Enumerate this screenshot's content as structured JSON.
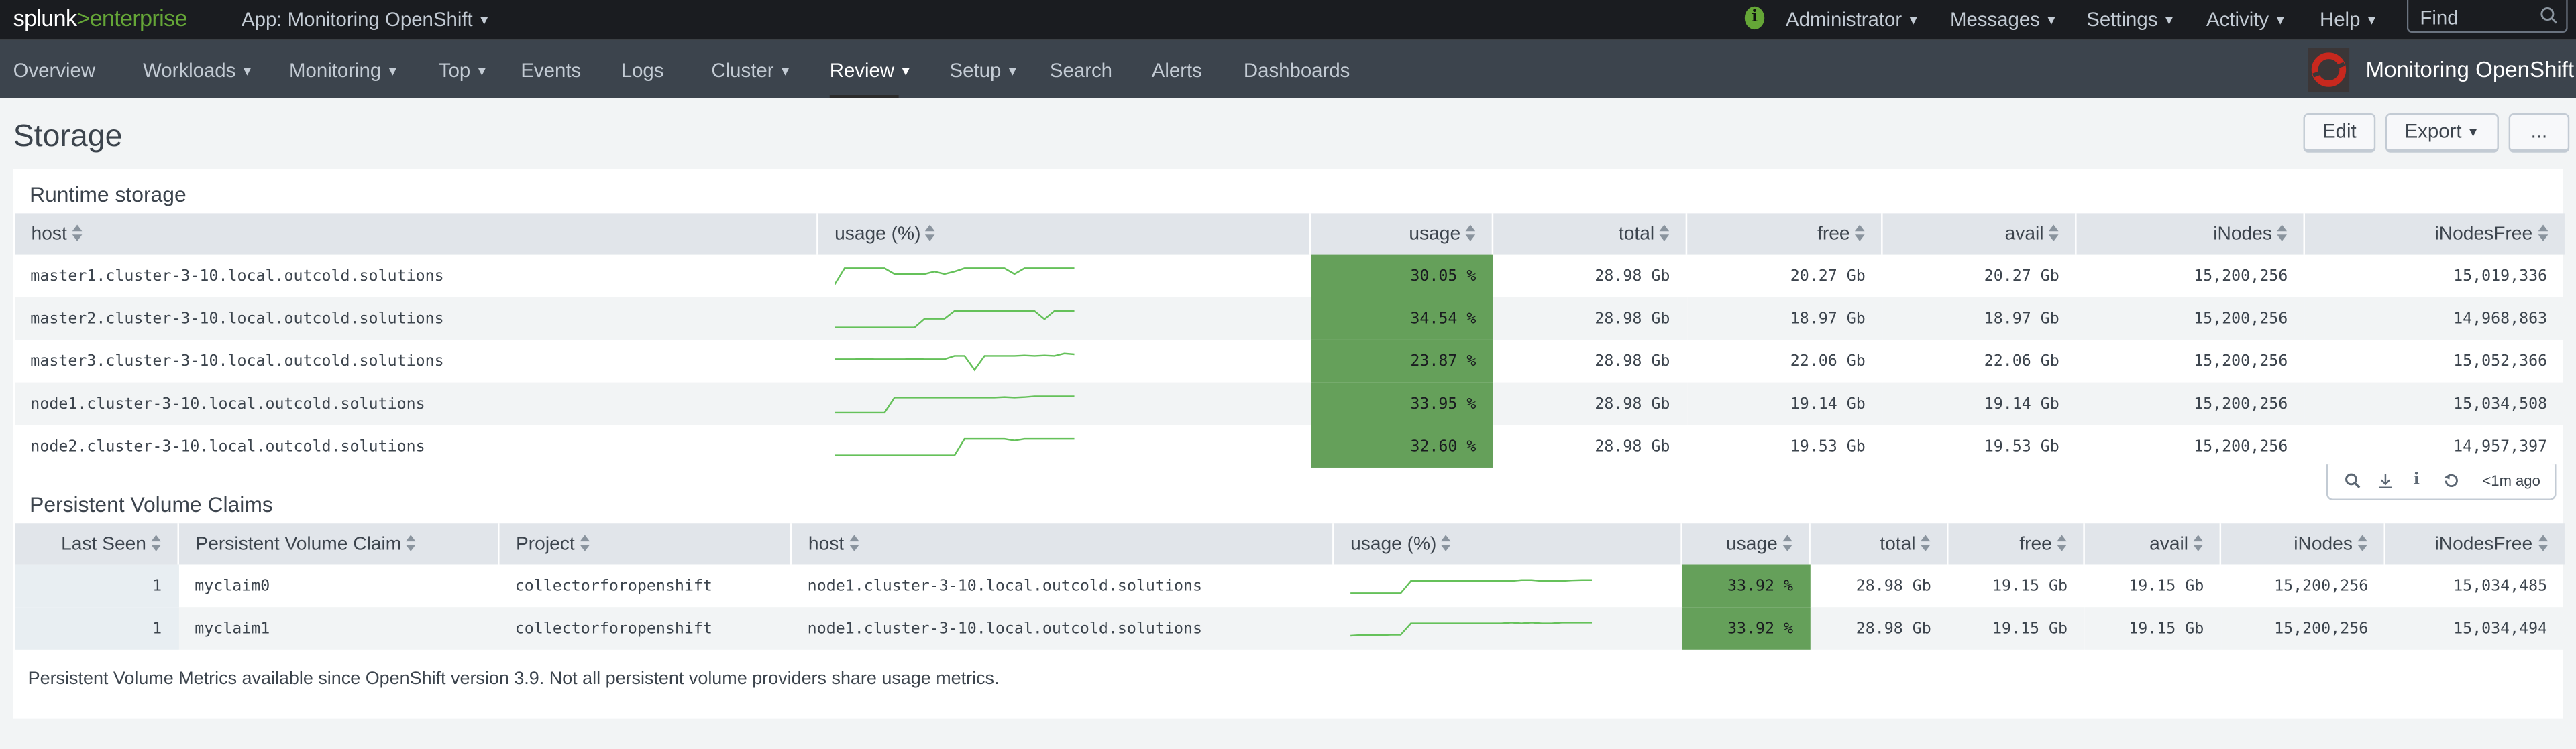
{
  "topbar": {
    "logo_text": "splunk>enterprise",
    "logo_a": "splunk",
    "logo_b": ">enterprise",
    "app": "App: Monitoring OpenShift",
    "admin": "Administrator",
    "messages": "Messages",
    "settings": "Settings",
    "activity": "Activity",
    "help": "Help",
    "find_placeholder": "Find"
  },
  "nav": {
    "items": [
      "Overview",
      "Workloads",
      "Monitoring",
      "Top",
      "Events",
      "Logs",
      "Cluster",
      "Review",
      "Setup",
      "Search",
      "Alerts",
      "Dashboards"
    ],
    "active": "Review",
    "app_title": "Monitoring OpenShift"
  },
  "page": {
    "title": "Storage",
    "edit": "Edit",
    "export": "Export",
    "more": "..."
  },
  "colors": {
    "accent": "#65a637",
    "usage_cell": "#65a05a",
    "sparkline": "#65c15a"
  },
  "runtime": {
    "title": "Runtime storage",
    "columns": [
      "host",
      "usage (%)",
      "usage",
      "total",
      "free",
      "avail",
      "iNodes",
      "iNodesFree"
    ],
    "rows": [
      {
        "host": "master1.cluster-3-10.local.outcold.solutions",
        "usage": "30.05 %",
        "total": "28.98 Gb",
        "free": "20.27 Gb",
        "avail": "20.27 Gb",
        "inodes": "15,200,256",
        "inodes_free": "15,019,336",
        "spark": [
          0,
          1,
          1,
          1,
          1,
          1,
          0.65,
          0.65,
          0.65,
          0.65,
          0.8,
          0.65,
          0.8,
          1,
          1,
          1,
          1,
          1,
          0.65,
          1,
          1,
          1,
          1,
          1,
          1
        ]
      },
      {
        "host": "master2.cluster-3-10.local.outcold.solutions",
        "usage": "34.54 %",
        "total": "28.98 Gb",
        "free": "18.97 Gb",
        "avail": "18.97 Gb",
        "inodes": "15,200,256",
        "inodes_free": "14,968,863",
        "spark": [
          0,
          0,
          0,
          0,
          0,
          0,
          0,
          0,
          0,
          0.53,
          0.53,
          0.53,
          1,
          1,
          1,
          1,
          1,
          1,
          1,
          1,
          1,
          0.5,
          1,
          1,
          1
        ]
      },
      {
        "host": "master3.cluster-3-10.local.outcold.solutions",
        "usage": "23.87 %",
        "total": "28.98 Gb",
        "free": "22.06 Gb",
        "avail": "22.06 Gb",
        "inodes": "15,200,256",
        "inodes_free": "15,052,366",
        "spark": [
          0.65,
          0.65,
          0.65,
          0.68,
          0.65,
          0.65,
          0.65,
          0.65,
          0.68,
          0.65,
          0.65,
          0.65,
          0.85,
          0.85,
          0,
          0.85,
          0.85,
          0.85,
          0.85,
          0.88,
          0.85,
          0.88,
          0.85,
          1,
          0.95
        ]
      },
      {
        "host": "node1.cluster-3-10.local.outcold.solutions",
        "usage": "33.95 %",
        "total": "28.98 Gb",
        "free": "19.14 Gb",
        "avail": "19.14 Gb",
        "inodes": "15,200,256",
        "inodes_free": "15,034,508",
        "spark": [
          0,
          0,
          0,
          0,
          0,
          0,
          0.92,
          0.92,
          0.92,
          0.92,
          0.92,
          0.92,
          0.92,
          0.92,
          0.92,
          0.92,
          0.92,
          0.95,
          0.92,
          0.95,
          1,
          1,
          1,
          1,
          1
        ]
      },
      {
        "host": "node2.cluster-3-10.local.outcold.solutions",
        "usage": "32.60 %",
        "total": "28.98 Gb",
        "free": "19.53 Gb",
        "avail": "19.53 Gb",
        "inodes": "15,200,256",
        "inodes_free": "14,957,397",
        "spark": [
          0,
          0,
          0,
          0,
          0,
          0,
          0,
          0,
          0,
          0,
          0,
          0,
          0,
          1,
          1,
          1,
          1,
          1,
          0.9,
          1,
          1,
          1,
          1,
          1,
          1
        ]
      }
    ]
  },
  "tools": {
    "last_refresh": "<1m ago"
  },
  "pvc": {
    "title": "Persistent Volume Claims",
    "columns": [
      "Last Seen",
      "Persistent Volume Claim",
      "Project",
      "host",
      "usage (%)",
      "usage",
      "total",
      "free",
      "avail",
      "iNodes",
      "iNodesFree"
    ],
    "rows": [
      {
        "last_seen": "1",
        "claim": "myclaim0",
        "project": "collectorforopenshift",
        "host": "node1.cluster-3-10.local.outcold.solutions",
        "usage": "33.92 %",
        "total": "28.98 Gb",
        "free": "19.15 Gb",
        "avail": "19.15 Gb",
        "inodes": "15,200,256",
        "inodes_free": "15,034,485",
        "spark": [
          0,
          0,
          0,
          0,
          0,
          0,
          1,
          1,
          1,
          1,
          1,
          1,
          1,
          1,
          1,
          1,
          1,
          1.08,
          1.08,
          1,
          1,
          1,
          1.05,
          1.08,
          1.08
        ]
      },
      {
        "last_seen": "1",
        "claim": "myclaim1",
        "project": "collectorforopenshift",
        "host": "node1.cluster-3-10.local.outcold.solutions",
        "usage": "33.92 %",
        "total": "28.98 Gb",
        "free": "19.15 Gb",
        "avail": "19.15 Gb",
        "inodes": "15,200,256",
        "inodes_free": "15,034,494",
        "spark": [
          0,
          0.05,
          0.05,
          0.04,
          0.08,
          0.08,
          1,
          1,
          1,
          1,
          1,
          1,
          1,
          1,
          1,
          1,
          1.06,
          1,
          1.06,
          1,
          1,
          1.06,
          1.06,
          1.06,
          1.06
        ]
      }
    ],
    "note": "Persistent Volume Metrics available since OpenShift version 3.9. Not all persistent volume providers share usage metrics."
  }
}
